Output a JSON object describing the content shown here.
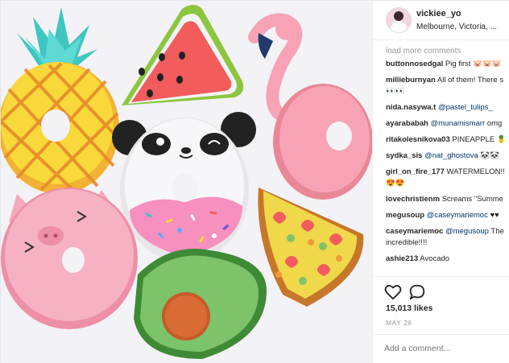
{
  "post": {
    "image_description": "",
    "colors": {
      "background": "#f1f1f3",
      "pink": "#f7a3b5",
      "pineapple": "#f7d33b",
      "watermelon": "#f25c5c",
      "avocado": "#7cc36a",
      "pizza": "#f0d84a"
    }
  },
  "header": {
    "username": "vickiee_yo",
    "location": "Melbourne, Victoria, ..."
  },
  "comments_section": {
    "load_more": "load more comments",
    "comments": [
      {
        "user": "buttonnosedgal",
        "text": "Pig first 🐷🐷🐷"
      },
      {
        "user": "millieburnyan",
        "text": "All of them! There s",
        "extra": "👀👀"
      },
      {
        "user": "nida.nasywa.t",
        "mention": "@pastel_tulips_",
        "text": ""
      },
      {
        "user": "ayarababah",
        "mention": "@munamismarr",
        "text": " omg"
      },
      {
        "user": "ritakolesnikova03",
        "text": " PINEAPPLE 🍍🍍"
      },
      {
        "user": "sydka_sis",
        "mention": "@nat_ghostova",
        "text": " 🐼🐼"
      },
      {
        "user": "girl_on_fire_177",
        "text": " WATERMELON!!",
        "extra": "😍😍"
      },
      {
        "user": "lovechristienm",
        "text": " Screams \"Summe"
      },
      {
        "user": "megusoup",
        "mention": "@caseymariemoc",
        "text": " ♥♥"
      },
      {
        "user": "caseymariemoc",
        "mention": "@megusoup",
        "text": " The",
        "extra": "incredible!!!!"
      },
      {
        "user": "ashie213",
        "text": " Avocado"
      }
    ]
  },
  "actions": {
    "heart_icon": "heart-outline",
    "comment_icon": "speech-bubble",
    "likes": "15,013 likes",
    "date": "MAY 26"
  },
  "add_comment": {
    "placeholder": "Add a comment..."
  }
}
